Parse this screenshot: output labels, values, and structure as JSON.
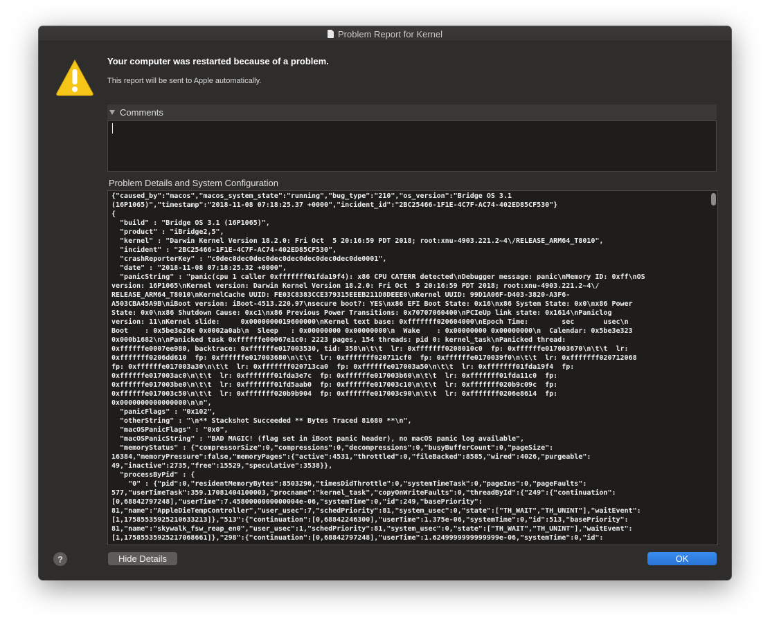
{
  "window": {
    "title": "Problem Report for Kernel"
  },
  "header": {
    "headline": "Your computer was restarted because of a problem.",
    "subline": "This report will be sent to Apple automatically.",
    "icon": "warning-triangle-icon"
  },
  "comments": {
    "label": "Comments",
    "value": ""
  },
  "details": {
    "label": "Problem Details and System Configuration",
    "text": "{\"caused_by\":\"macos\",\"macos_system_state\":\"running\",\"bug_type\":\"210\",\"os_version\":\"Bridge OS 3.1\n(16P1065)\",\"timestamp\":\"2018-11-08 07:18:25.37 +0000\",\"incident_id\":\"2BC25466-1F1E-4C7F-AC74-402ED85CF530\"}\n{\n  \"build\" : \"Bridge OS 3.1 (16P1065)\",\n  \"product\" : \"iBridge2,5\",\n  \"kernel\" : \"Darwin Kernel Version 18.2.0: Fri Oct  5 20:16:59 PDT 2018; root:xnu-4903.221.2~4\\/RELEASE_ARM64_T8010\",\n  \"incident\" : \"2BC25466-1F1E-4C7F-AC74-402ED85CF530\",\n  \"crashReporterKey\" : \"c0dec0dec0dec0dec0dec0dec0dec0dec0de0001\",\n  \"date\" : \"2018-11-08 07:18:25.32 +0000\",\n  \"panicString\" : \"panic(cpu 1 caller 0xfffffff01fda19f4): x86 CPU CATERR detected\\nDebugger message: panic\\nMemory ID: 0xff\\nOS\nversion: 16P1065\\nKernel version: Darwin Kernel Version 18.2.0: Fri Oct  5 20:16:59 PDT 2018; root:xnu-4903.221.2~4\\/\nRELEASE_ARM64_T8010\\nKernelCache UUID: FE03C8383CCE379315EEEB211D8DEEE0\\nKernel UUID: 99D1A06F-D403-3820-A3F6-\nA503CBA45A9B\\niBoot version: iBoot-4513.220.97\\nsecure boot?: YES\\nx86 EFI Boot State: 0x16\\nx86 System State: 0x0\\nx86 Power\nState: 0x0\\nx86 Shutdown Cause: 0xc1\\nx86 Previous Power Transitions: 0x70707060400\\nPCIeUp link state: 0x1614\\nPaniclog\nversion: 11\\nKernel slide:     0x0000000019600000\\nKernel text base: 0xfffffff020604000\\nEpoch Time:        sec       usec\\n\nBoot    : 0x5be3e26e 0x0002a0ab\\n  Sleep   : 0x00000000 0x00000000\\n  Wake    : 0x00000000 0x00000000\\n  Calendar: 0x5be3e323\n0x000b1682\\n\\nPanicked task 0xffffffe00067e1c0: 2223 pages, 154 threads: pid 0: kernel_task\\nPanicked thread:\n0xffffffe0007ee980, backtrace: 0xffffffe017003530, tid: 358\\n\\t\\t  lr: 0xfffffff0208010c0  fp: 0xffffffe017003670\\n\\t\\t  lr:\n0xfffffff0206dd610  fp: 0xffffffe017003680\\n\\t\\t  lr: 0xfffffff020711cf0  fp: 0xffffffe0170039f0\\n\\t\\t  lr: 0xfffffff020712068\nfp: 0xffffffe017003a30\\n\\t\\t  lr: 0xfffffff020713ca0  fp: 0xffffffe017003a50\\n\\t\\t  lr: 0xfffffff01fda19f4  fp:\n0xffffffe017003ac0\\n\\t\\t  lr: 0xfffffff01fda3e7c  fp: 0xffffffe017003b60\\n\\t\\t  lr: 0xfffffff01fda11c0  fp:\n0xffffffe017003be0\\n\\t\\t  lr: 0xfffffff01fd5aab0  fp: 0xffffffe017003c10\\n\\t\\t  lr: 0xfffffff020b9c09c  fp:\n0xffffffe017003c50\\n\\t\\t  lr: 0xfffffff020b9b904  fp: 0xffffffe017003c90\\n\\t\\t  lr: 0xfffffff0206e8614  fp:\n0x0000000000000000\\n\\n\",\n  \"panicFlags\" : \"0x102\",\n  \"otherString\" : \"\\n** Stackshot Succeeded ** Bytes Traced 81680 **\\n\",\n  \"macOSPanicFlags\" : \"0x0\",\n  \"macOSPanicString\" : \"BAD MAGIC! (flag set in iBoot panic header), no macOS panic log available\",\n  \"memoryStatus\" : {\"compressorSize\":0,\"compressions\":0,\"decompressions\":0,\"busyBufferCount\":0,\"pageSize\":\n16384,\"memoryPressure\":false,\"memoryPages\":{\"active\":4531,\"throttled\":0,\"fileBacked\":8585,\"wired\":4026,\"purgeable\":\n49,\"inactive\":2735,\"free\":15529,\"speculative\":3538}},\n  \"processByPid\" : {\n    \"0\" : {\"pid\":0,\"residentMemoryBytes\":8503296,\"timesDidThrottle\":0,\"systemTimeTask\":0,\"pageIns\":0,\"pageFaults\":\n577,\"userTimeTask\":359.17081404100003,\"procname\":\"kernel_task\",\"copyOnWriteFaults\":0,\"threadById\":{\"249\":{\"continuation\":\n[0,68842797248],\"userTime\":7.4580000000000004e-06,\"systemTime\":0,\"id\":249,\"basePriority\":\n81,\"name\":\"AppleDieTempController\",\"user_usec\":7,\"schedPriority\":81,\"system_usec\":0,\"state\":[\"TH_WAIT\",\"TH_UNINT\"],\"waitEvent\":\n[1,17585535925210633213]},\"513\":{\"continuation\":[0,68842246300],\"userTime\":1.375e-06,\"systemTime\":0,\"id\":513,\"basePriority\":\n81,\"name\":\"skywalk_fsw_reap_en0\",\"user_usec\":1,\"schedPriority\":81,\"system_usec\":0,\"state\":[\"TH_WAIT\",\"TH_UNINT\"],\"waitEvent\":\n[1,17585535925217068661]},\"298\":{\"continuation\":[0,68842797248],\"userTime\":1.6249999999999999e-06,\"systemTime\":0,\"id\":"
  },
  "buttons": {
    "help": "?",
    "hide_details": "Hide Details",
    "ok": "OK"
  }
}
